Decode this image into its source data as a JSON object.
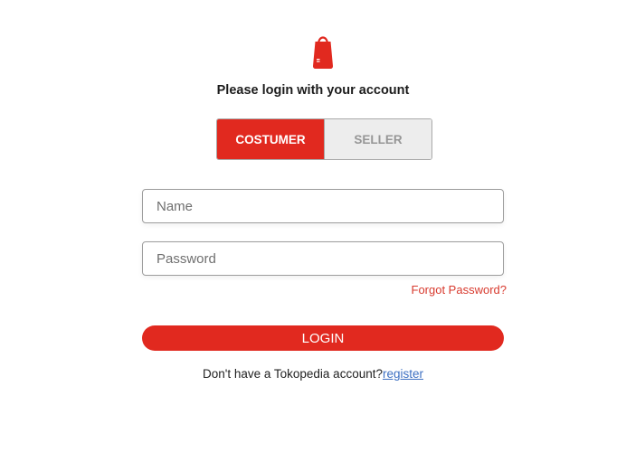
{
  "brand": {
    "logo_icon": "shopping-bag-icon",
    "logo_color": "#e1291f"
  },
  "heading": "Please login with your account",
  "role_toggle": {
    "options": [
      "COSTUMER",
      "SELLER"
    ],
    "selected": "COSTUMER",
    "active_color": "#e1291f",
    "inactive_color": "#ededed"
  },
  "form": {
    "name_placeholder": "Name",
    "name_value": "",
    "password_placeholder": "Password",
    "password_value": "",
    "forgot_label": "Forgot Password?",
    "login_label": "LOGIN"
  },
  "footer": {
    "prompt": "Don't have a Tokopedia account?",
    "register_label": "register",
    "link_color": "#3c6fc2"
  }
}
